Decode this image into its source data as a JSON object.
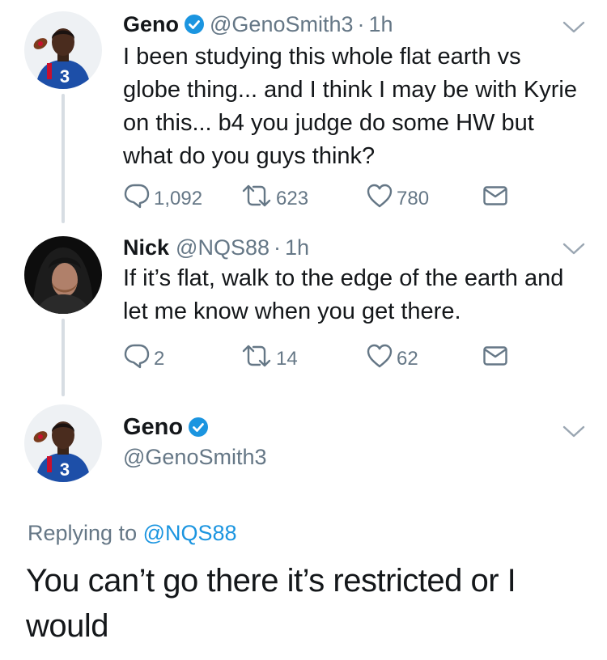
{
  "colors": {
    "accent": "#1b95e0",
    "muted": "#657786",
    "text": "#14171a",
    "jersey": "#1d4fa8"
  },
  "tweets": [
    {
      "name": "Geno",
      "handle": "@GenoSmith3",
      "separator": "·",
      "time": "1h",
      "verified": true,
      "avatar_icon": "football-player-avatar",
      "text": "I been studying this whole flat earth vs globe thing... and I think I may be with Kyrie on this... b4 you judge do some HW but what do you guys think?",
      "replies": "1,092",
      "retweets": "623",
      "likes": "780"
    },
    {
      "name": "Nick",
      "handle": "@NQS88",
      "separator": "·",
      "time": "1h",
      "verified": false,
      "avatar_icon": "hooded-person-avatar",
      "text": "If it’s flat, walk to the edge of the earth and let me know when you get there.",
      "replies": "2",
      "retweets": "14",
      "likes": "62"
    }
  ],
  "focused": {
    "name": "Geno",
    "handle": "@GenoSmith3",
    "verified": true,
    "replying_prefix": "Replying to ",
    "replying_to": "@NQS88",
    "text": "You can’t go there it’s restricted or I would"
  }
}
